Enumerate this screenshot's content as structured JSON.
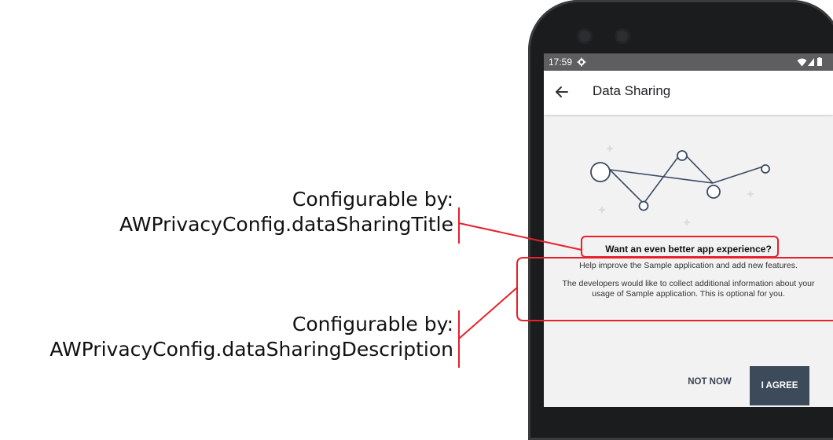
{
  "annotations": [
    {
      "line1": "Configurable by:",
      "line2": "AWPrivacyConfig.dataSharingTitle"
    },
    {
      "line1": "Configurable by:",
      "line2": "AWPrivacyConfig.dataSharingDescription"
    }
  ],
  "status_bar": {
    "time": "17:59"
  },
  "app_bar": {
    "title": "Data Sharing"
  },
  "content": {
    "title": "Want an even better app experience?",
    "description_1": "Help improve the Sample application and add new features.",
    "description_2": "The developers would like to collect additional information about your usage of Sample application. This is optional for you."
  },
  "buttons": {
    "not_now": "NOT NOW",
    "agree": "I AGREE"
  },
  "colors": {
    "highlight": "#e8202a",
    "agree_button": "#3d4a5a",
    "status_bar": "#5e5e60"
  }
}
